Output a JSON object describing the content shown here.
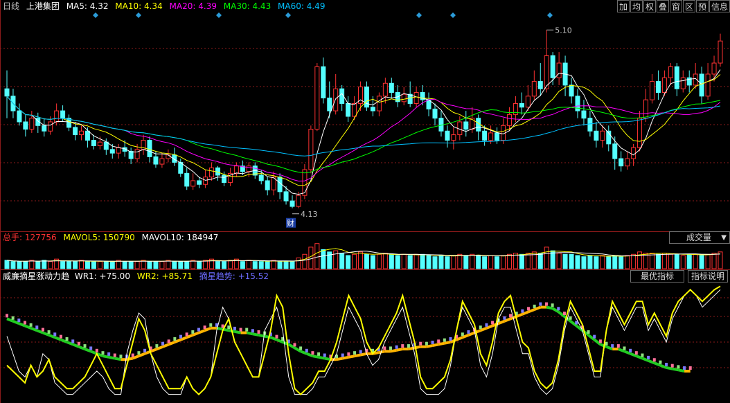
{
  "header": {
    "period": "日线",
    "stock": "上港集团",
    "ma": [
      {
        "label": "MA5: 4.32",
        "color": "#ffffff"
      },
      {
        "label": "MA10: 4.34",
        "color": "#ffff00"
      },
      {
        "label": "MA20: 4.39",
        "color": "#ff00ff"
      },
      {
        "label": "MA30: 4.43",
        "color": "#00ff00"
      },
      {
        "label": "MA60: 4.49",
        "color": "#00c0ff"
      }
    ]
  },
  "toolbar": [
    "加",
    "均",
    "权",
    "叠",
    "窗",
    "区",
    "预",
    "信息"
  ],
  "volume_panel": {
    "total_label": "总手: 127756",
    "mavol5": "MAVOL5: 150790",
    "mavol10": "MAVOL10: 184947",
    "dropdown": "成交量"
  },
  "indicator_panel": {
    "name": "威廉摘星涨动力趋",
    "wr1": "WR1: +75.00",
    "wr2": "WR2: +85.71",
    "trend": "摘星趋势: +15.52",
    "best_button": "最优指标",
    "help_button": "指标说明"
  },
  "markers": {
    "high": "5.10",
    "low": "4.13",
    "fin": "财"
  },
  "colors": {
    "up": "#ff3232",
    "down": "#54ffff",
    "ma5": "#ffffff",
    "ma10": "#ffff00",
    "ma20": "#ff00ff",
    "ma30": "#00ff00",
    "ma60": "#00c0ff",
    "grid": "#8b1a1a"
  },
  "chart_data": {
    "type": "candlestick",
    "title": "上港集团 日线",
    "ylim": [
      4.05,
      5.15
    ],
    "ohlc": [
      [
        4.78,
        4.74,
        4.88,
        4.62
      ],
      [
        4.74,
        4.66,
        4.78,
        4.62
      ],
      [
        4.66,
        4.6,
        4.7,
        4.58
      ],
      [
        4.6,
        4.56,
        4.64,
        4.52
      ],
      [
        4.56,
        4.62,
        4.66,
        4.54
      ],
      [
        4.62,
        4.58,
        4.65,
        4.54
      ],
      [
        4.58,
        4.55,
        4.62,
        4.52
      ],
      [
        4.55,
        4.6,
        4.63,
        4.53
      ],
      [
        4.6,
        4.66,
        4.7,
        4.58
      ],
      [
        4.66,
        4.62,
        4.69,
        4.6
      ],
      [
        4.62,
        4.57,
        4.64,
        4.55
      ],
      [
        4.57,
        4.53,
        4.6,
        4.5
      ],
      [
        4.53,
        4.55,
        4.58,
        4.5
      ],
      [
        4.55,
        4.5,
        4.57,
        4.46
      ],
      [
        4.5,
        4.47,
        4.53,
        4.45
      ],
      [
        4.47,
        4.49,
        4.52,
        4.45
      ],
      [
        4.49,
        4.45,
        4.51,
        4.42
      ],
      [
        4.45,
        4.43,
        4.48,
        4.4
      ],
      [
        4.43,
        4.46,
        4.48,
        4.4
      ],
      [
        4.46,
        4.44,
        4.5,
        4.41
      ],
      [
        4.44,
        4.4,
        4.46,
        4.37
      ],
      [
        4.4,
        4.45,
        4.48,
        4.38
      ],
      [
        4.45,
        4.5,
        4.53,
        4.42
      ],
      [
        4.5,
        4.41,
        4.52,
        4.38
      ],
      [
        4.41,
        4.37,
        4.44,
        4.35
      ],
      [
        4.37,
        4.4,
        4.43,
        4.35
      ],
      [
        4.4,
        4.42,
        4.45,
        4.38
      ],
      [
        4.42,
        4.38,
        4.46,
        4.36
      ],
      [
        4.38,
        4.32,
        4.4,
        4.3
      ],
      [
        4.32,
        4.25,
        4.35,
        4.23
      ],
      [
        4.25,
        4.28,
        4.32,
        4.23
      ],
      [
        4.28,
        4.26,
        4.3,
        4.24
      ],
      [
        4.26,
        4.3,
        4.34,
        4.24
      ],
      [
        4.3,
        4.35,
        4.38,
        4.28
      ],
      [
        4.35,
        4.31,
        4.36,
        4.28
      ],
      [
        4.31,
        4.27,
        4.33,
        4.25
      ],
      [
        4.27,
        4.32,
        4.35,
        4.25
      ],
      [
        4.32,
        4.36,
        4.38,
        4.3
      ],
      [
        4.36,
        4.33,
        4.39,
        4.31
      ],
      [
        4.33,
        4.36,
        4.38,
        4.3
      ],
      [
        4.36,
        4.31,
        4.38,
        4.29
      ],
      [
        4.31,
        4.28,
        4.34,
        4.26
      ],
      [
        4.28,
        4.23,
        4.3,
        4.2
      ],
      [
        4.23,
        4.3,
        4.33,
        4.2
      ],
      [
        4.3,
        4.22,
        4.32,
        4.18
      ],
      [
        4.22,
        4.17,
        4.25,
        4.15
      ],
      [
        4.17,
        4.14,
        4.2,
        4.13
      ],
      [
        4.14,
        4.2,
        4.22,
        4.13
      ],
      [
        4.2,
        4.34,
        4.37,
        4.18
      ],
      [
        4.34,
        4.56,
        4.58,
        4.32
      ],
      [
        4.56,
        4.9,
        4.92,
        4.55
      ],
      [
        4.9,
        4.73,
        4.95,
        4.7
      ],
      [
        4.73,
        4.66,
        4.82,
        4.62
      ],
      [
        4.66,
        4.78,
        4.86,
        4.64
      ],
      [
        4.78,
        4.7,
        4.8,
        4.66
      ],
      [
        4.7,
        4.63,
        4.74,
        4.6
      ],
      [
        4.63,
        4.7,
        4.74,
        4.61
      ],
      [
        4.7,
        4.79,
        4.82,
        4.66
      ],
      [
        4.79,
        4.68,
        4.82,
        4.66
      ],
      [
        4.68,
        4.66,
        4.74,
        4.63
      ],
      [
        4.66,
        4.74,
        4.76,
        4.63
      ],
      [
        4.74,
        4.81,
        4.84,
        4.7
      ],
      [
        4.81,
        4.76,
        4.84,
        4.73
      ],
      [
        4.76,
        4.71,
        4.8,
        4.68
      ],
      [
        4.71,
        4.75,
        4.79,
        4.69
      ],
      [
        4.75,
        4.7,
        4.82,
        4.68
      ],
      [
        4.7,
        4.76,
        4.79,
        4.68
      ],
      [
        4.76,
        4.72,
        4.8,
        4.69
      ],
      [
        4.72,
        4.67,
        4.76,
        4.63
      ],
      [
        4.67,
        4.62,
        4.7,
        4.58
      ],
      [
        4.62,
        4.55,
        4.66,
        4.52
      ],
      [
        4.55,
        4.5,
        4.58,
        4.46
      ],
      [
        4.5,
        4.53,
        4.57,
        4.45
      ],
      [
        4.53,
        4.6,
        4.63,
        4.5
      ],
      [
        4.6,
        4.56,
        4.66,
        4.52
      ],
      [
        4.56,
        4.62,
        4.68,
        4.54
      ],
      [
        4.62,
        4.55,
        4.64,
        4.5
      ],
      [
        4.55,
        4.5,
        4.58,
        4.47
      ],
      [
        4.5,
        4.54,
        4.58,
        4.48
      ],
      [
        4.54,
        4.5,
        4.57,
        4.48
      ],
      [
        4.5,
        4.58,
        4.62,
        4.48
      ],
      [
        4.58,
        4.64,
        4.68,
        4.55
      ],
      [
        4.64,
        4.7,
        4.74,
        4.6
      ],
      [
        4.7,
        4.68,
        4.76,
        4.64
      ],
      [
        4.68,
        4.74,
        4.8,
        4.66
      ],
      [
        4.74,
        4.82,
        4.88,
        4.72
      ],
      [
        4.82,
        4.78,
        4.92,
        4.74
      ],
      [
        4.78,
        4.96,
        5.1,
        4.76
      ],
      [
        4.96,
        4.84,
        4.98,
        4.8
      ],
      [
        4.84,
        4.92,
        4.98,
        4.8
      ],
      [
        4.92,
        4.8,
        4.96,
        4.74
      ],
      [
        4.8,
        4.74,
        4.84,
        4.7
      ],
      [
        4.74,
        4.66,
        4.78,
        4.62
      ],
      [
        4.66,
        4.62,
        4.72,
        4.58
      ],
      [
        4.62,
        4.55,
        4.66,
        4.52
      ],
      [
        4.55,
        4.5,
        4.6,
        4.46
      ],
      [
        4.5,
        4.55,
        4.58,
        4.46
      ],
      [
        4.55,
        4.48,
        4.58,
        4.44
      ],
      [
        4.48,
        4.4,
        4.52,
        4.34
      ],
      [
        4.4,
        4.36,
        4.44,
        4.33
      ],
      [
        4.36,
        4.4,
        4.44,
        4.34
      ],
      [
        4.4,
        4.46,
        4.48,
        4.36
      ],
      [
        4.46,
        4.62,
        4.66,
        4.44
      ],
      [
        4.62,
        4.72,
        4.78,
        4.6
      ],
      [
        4.72,
        4.82,
        4.86,
        4.7
      ],
      [
        4.82,
        4.76,
        4.88,
        4.72
      ],
      [
        4.76,
        4.84,
        4.88,
        4.74
      ],
      [
        4.84,
        4.9,
        4.92,
        4.8
      ],
      [
        4.9,
        4.78,
        4.92,
        4.74
      ],
      [
        4.78,
        4.84,
        4.88,
        4.76
      ],
      [
        4.84,
        4.8,
        4.88,
        4.76
      ],
      [
        4.8,
        4.86,
        4.92,
        4.78
      ],
      [
        4.86,
        4.74,
        4.9,
        4.7
      ],
      [
        4.74,
        4.86,
        4.92,
        4.72
      ],
      [
        4.86,
        4.92,
        4.96,
        4.82
      ],
      [
        4.92,
        5.04,
        5.08,
        4.9
      ]
    ]
  },
  "volume_data": [
    7,
    6,
    6,
    6,
    7,
    6,
    7,
    6,
    8,
    6,
    6,
    6,
    7,
    6,
    6,
    6,
    6,
    6,
    7,
    6,
    6,
    6,
    7,
    6,
    6,
    6,
    7,
    6,
    6,
    6,
    7,
    6,
    7,
    8,
    6,
    6,
    7,
    8,
    6,
    7,
    6,
    6,
    6,
    7,
    6,
    6,
    6,
    9,
    12,
    18,
    21,
    16,
    14,
    15,
    13,
    11,
    12,
    14,
    12,
    11,
    12,
    13,
    12,
    11,
    12,
    11,
    12,
    12,
    11,
    10,
    11,
    10,
    11,
    12,
    11,
    12,
    11,
    10,
    11,
    10,
    11,
    12,
    13,
    12,
    13,
    14,
    13,
    18,
    15,
    13,
    12,
    12,
    11,
    10,
    11,
    10,
    11,
    10,
    11,
    10,
    11,
    12,
    14,
    13,
    13,
    12,
    13,
    12,
    12,
    11,
    12,
    12,
    11,
    12,
    13,
    14
  ],
  "indicator_data": {
    "wr_white": [
      55,
      40,
      25,
      20,
      30,
      20,
      40,
      35,
      15,
      10,
      5,
      5,
      10,
      15,
      20,
      25,
      20,
      10,
      5,
      5,
      40,
      60,
      75,
      70,
      40,
      20,
      10,
      5,
      5,
      5,
      20,
      10,
      5,
      10,
      20,
      60,
      80,
      70,
      50,
      40,
      30,
      20,
      20,
      60,
      70,
      80,
      60,
      20,
      5,
      5,
      5,
      10,
      20,
      20,
      30,
      40,
      60,
      80,
      70,
      60,
      40,
      30,
      35,
      50,
      60,
      70,
      80,
      60,
      40,
      10,
      5,
      5,
      5,
      10,
      30,
      60,
      80,
      70,
      60,
      30,
      20,
      40,
      70,
      80,
      80,
      60,
      40,
      40,
      20,
      10,
      5,
      10,
      30,
      60,
      80,
      70,
      60,
      40,
      20,
      20,
      60,
      80,
      70,
      60,
      70,
      80,
      80,
      60,
      70,
      60,
      50,
      70,
      80,
      90,
      95,
      90,
      80,
      85,
      90,
      95
    ],
    "wr_yellow": [
      30,
      25,
      20,
      15,
      30,
      20,
      25,
      35,
      20,
      15,
      10,
      10,
      15,
      20,
      30,
      40,
      30,
      20,
      10,
      10,
      30,
      50,
      70,
      60,
      40,
      30,
      20,
      10,
      10,
      10,
      20,
      10,
      5,
      10,
      20,
      40,
      60,
      70,
      50,
      40,
      30,
      20,
      20,
      40,
      60,
      90,
      80,
      40,
      10,
      5,
      10,
      15,
      25,
      25,
      35,
      50,
      70,
      90,
      80,
      70,
      50,
      40,
      45,
      55,
      65,
      75,
      90,
      70,
      50,
      20,
      10,
      10,
      15,
      20,
      35,
      60,
      85,
      75,
      65,
      40,
      30,
      50,
      75,
      85,
      90,
      70,
      50,
      45,
      25,
      15,
      10,
      15,
      35,
      65,
      85,
      75,
      65,
      45,
      25,
      25,
      60,
      85,
      75,
      65,
      75,
      85,
      85,
      65,
      75,
      65,
      55,
      75,
      85,
      90,
      95,
      90,
      85,
      90,
      95,
      98
    ],
    "trend": [
      70,
      68,
      66,
      64,
      62,
      60,
      58,
      56,
      54,
      52,
      50,
      48,
      46,
      44,
      42,
      40,
      38,
      37,
      36,
      35,
      35,
      36,
      38,
      40,
      42,
      44,
      46,
      48,
      50,
      52,
      54,
      56,
      58,
      60,
      62,
      62,
      61,
      60,
      59,
      58,
      58,
      57,
      56,
      55,
      54,
      52,
      50,
      48,
      45,
      42,
      40,
      38,
      37,
      36,
      35,
      35,
      36,
      37,
      38,
      39,
      40,
      40,
      41,
      42,
      42,
      43,
      44,
      44,
      45,
      46,
      46,
      47,
      48,
      49,
      50,
      52,
      54,
      56,
      58,
      60,
      62,
      64,
      66,
      68,
      70,
      72,
      74,
      76,
      78,
      80,
      80,
      79,
      76,
      72,
      68,
      64,
      60,
      56,
      52,
      48,
      46,
      44,
      44,
      42,
      40,
      38,
      36,
      34,
      32,
      30,
      28,
      27,
      26,
      25,
      25
    ]
  }
}
